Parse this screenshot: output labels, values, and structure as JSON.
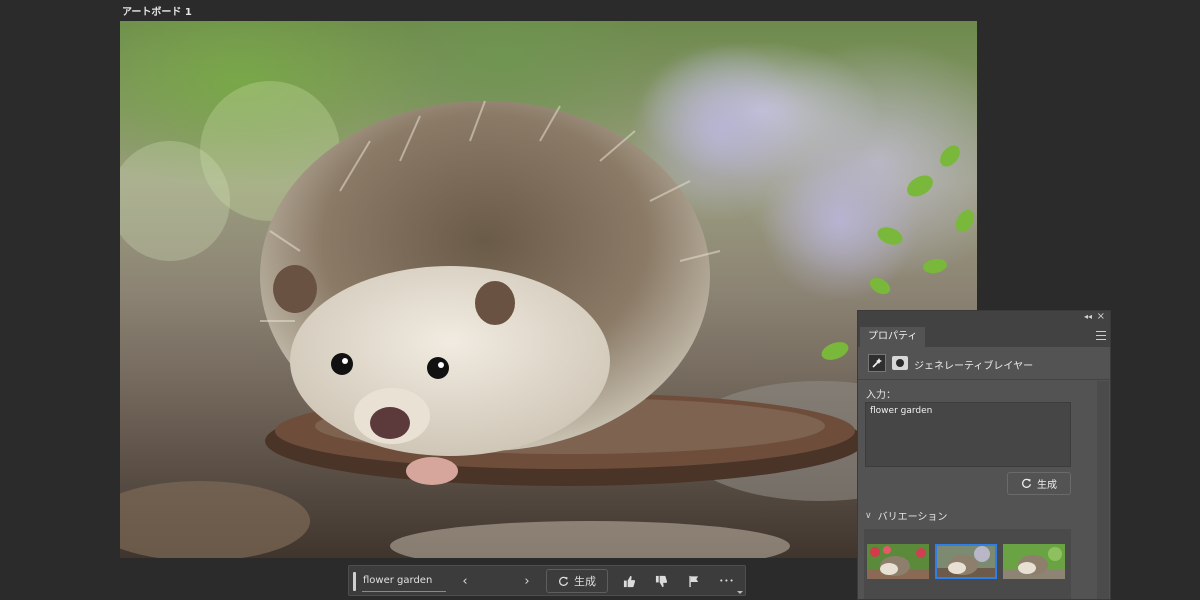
{
  "artboard": {
    "label": "アートボード 1"
  },
  "toolbar": {
    "prompt_value": "flower garden",
    "prev_glyph": "‹",
    "next_glyph": "›",
    "generate_label": "生成",
    "more_glyph": "•••"
  },
  "panel": {
    "tab_title": "プロパティ",
    "layer_type": "ジェネレーティブレイヤー",
    "input_label": "入力：",
    "prompt_text": "flower garden",
    "generate_label": "生成",
    "variations_label": "バリエーション",
    "variations_count": 3,
    "selected_variation": 2
  },
  "colors": {
    "background": "#2b2b2b",
    "panel": "#535353",
    "selection": "#2f7fe6"
  },
  "icons": [
    "refresh-icon",
    "chevron-left-icon",
    "chevron-right-icon",
    "thumbs-up-icon",
    "thumbs-down-icon",
    "flag-icon",
    "more-icon",
    "collapse-icon",
    "close-icon",
    "menu-icon",
    "generative-layer-icon",
    "layer-mask-icon",
    "chevron-down-icon"
  ]
}
